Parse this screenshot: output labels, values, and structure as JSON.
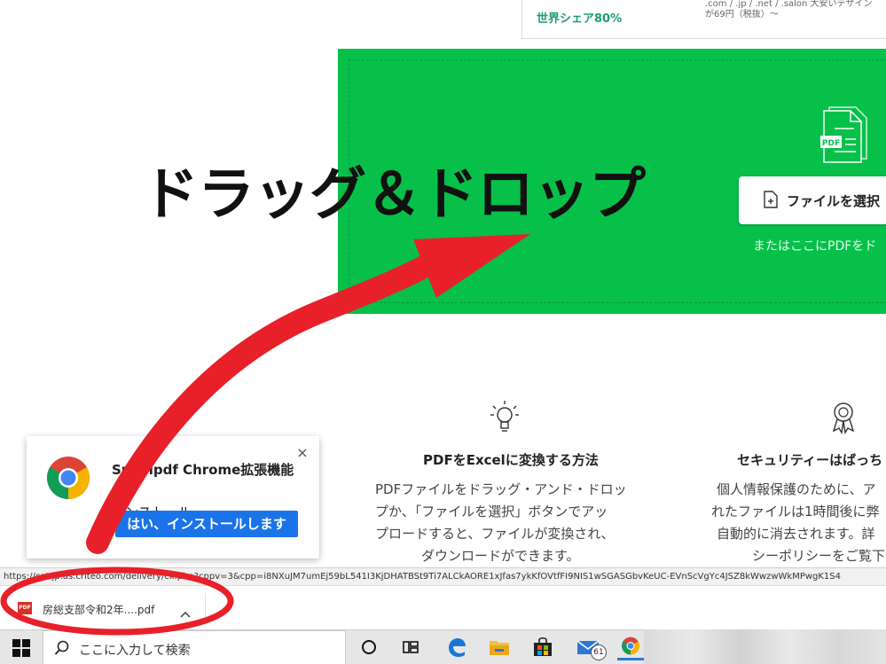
{
  "top_ad": {
    "share_text": "世界シェア80%",
    "price_line1": ".com / .jp / .net / .salon 大安いデザイン",
    "price_line2": "が69円（税抜）〜"
  },
  "dropzone": {
    "select_button_label": "ファイルを選択",
    "drop_hint": "またはここにPDFをド"
  },
  "annotation": {
    "title": "ドラッグ＆ドロップ"
  },
  "info": {
    "how_title": "PDFをExcelに変換する方法",
    "how_body": [
      "PDFファイルをドラッグ・アンド・ドロッ",
      "プか、「ファイルを選択」ボタンでアッ",
      "プロードすると、ファイルが変換され、",
      "ダウンロードができます。"
    ],
    "security_title": "セキュリティーはばっち",
    "security_body": [
      "個人情報保護のために、ア",
      "れたファイルは1時間後に弊",
      "自動的に消去されます。詳",
      "シーポリシーをご覧下"
    ]
  },
  "popup": {
    "title_bold": "Smallpdf Chrome拡張機能",
    "title_rest": "を",
    "title_line2": "インストール",
    "yes_button": "はい、インストールします",
    "close_label": "×"
  },
  "status_bar": {
    "url": "https://cat.jp.as.criteo.com/delivery/ck.php?cppv=3&cpp=i8NXuJM7umEj59bL541I3KjDHATBSt9Ti7ALCkAORE1xJfas7ykKfOVtfFI9NIS1wSGASGbvKeUC-EVnScVgYc4JSZ8kWwzwWkMPwgK1S4"
  },
  "download_shelf": {
    "file_name": "房総支部令和2年....pdf",
    "file_icon_text": "PDF"
  },
  "taskbar": {
    "search_placeholder": "ここに入力して検索",
    "mail_badge": "61"
  },
  "colors": {
    "dropzone_green": "#06c04a",
    "accent_blue": "#1a73e8",
    "annotation_red": "#e8202a"
  }
}
